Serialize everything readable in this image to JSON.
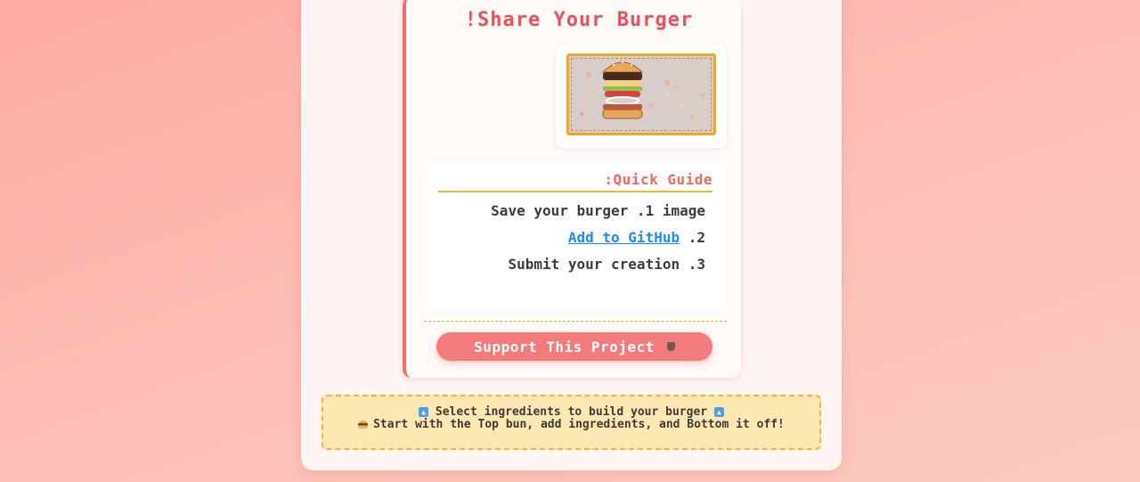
{
  "share": {
    "title": "!Share Your Burger"
  },
  "guide": {
    "title": ":Quick Guide",
    "items": [
      {
        "text": "Save your burger .1 image"
      },
      {
        "link_text": "Add to GitHub",
        "suffix": " .2"
      },
      {
        "text": "Submit your creation .3"
      }
    ]
  },
  "support": {
    "label": "Support This Project",
    "icon": "coffee-icon"
  },
  "info": {
    "line1": "Select ingredients to build your burger",
    "line2": "Start with the Top bun, add ingredients, and Bottom it off!",
    "icons": [
      "arrow-up-icon",
      "burger-icon"
    ]
  },
  "colors": {
    "accent": "#ef4f5c",
    "button": "#f47b7b",
    "link": "#1a8cff",
    "info_bg": "#fde8b4",
    "border_gold": "#f2a81e"
  }
}
